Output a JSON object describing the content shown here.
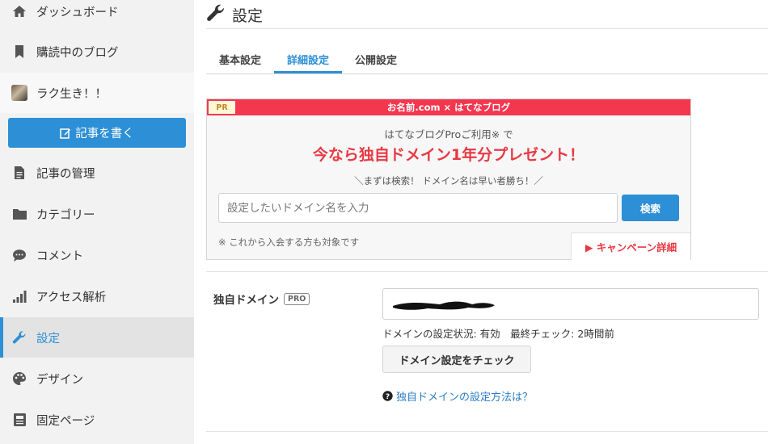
{
  "sidebar": {
    "items": [
      {
        "label": "ダッシュボード",
        "icon": "home-icon"
      },
      {
        "label": "購読中のブログ",
        "icon": "bookmark-icon"
      },
      {
        "label": "ラク生き！！",
        "icon": "blog-avatar"
      },
      {
        "label": "記事の管理",
        "icon": "document-icon"
      },
      {
        "label": "カテゴリー",
        "icon": "folder-icon"
      },
      {
        "label": "コメント",
        "icon": "comment-icon"
      },
      {
        "label": "アクセス解析",
        "icon": "bar-chart-icon"
      },
      {
        "label": "設定",
        "icon": "wrench-icon",
        "active": true
      },
      {
        "label": "デザイン",
        "icon": "palette-icon"
      },
      {
        "label": "固定ページ",
        "icon": "page-icon"
      }
    ],
    "write_button": "記事を書く"
  },
  "header": {
    "title": "設定"
  },
  "tabs": [
    {
      "label": "基本設定"
    },
    {
      "label": "詳細設定",
      "active": true
    },
    {
      "label": "公開設定"
    }
  ],
  "promo": {
    "badge": "PR",
    "bar_text": "お名前.com × はてなブログ",
    "subtitle": "はてなブログProご利用※ で",
    "headline": "今なら独自ドメイン1年分プレゼント！",
    "note": "＼まずは検索！ ドメイン名は早い者勝ち！／",
    "input_placeholder": "設定したいドメイン名を入力",
    "search_button": "検索",
    "footnote": "※ これから入会する方も対象です",
    "campaign_link": "▶ キャンペーン詳細"
  },
  "domain_section": {
    "label": "独自ドメイン",
    "pro_badge": "PRO",
    "status_text": "ドメインの設定状況: 有効　最終チェック: 2時間前",
    "check_button": "ドメイン設定をチェック",
    "help_link": "独自ドメインの設定方法は？"
  },
  "colors": {
    "accent": "#2d8fd5",
    "promo_red": "#f2374f",
    "headline_red": "#e83843",
    "sidebar_bg": "#f2f2f2"
  }
}
